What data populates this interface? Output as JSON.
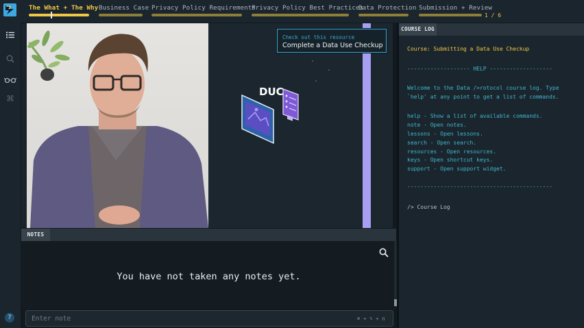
{
  "header": {
    "lessons": [
      {
        "label": "The What + The Why",
        "active": true
      },
      {
        "label": "Business Case",
        "active": false
      },
      {
        "label": "Privacy Policy Requirements",
        "active": false
      },
      {
        "label": "Privacy Policy Best Practices",
        "active": false
      },
      {
        "label": "Data Protection",
        "active": false
      },
      {
        "label": "Submission + Review",
        "active": false
      }
    ],
    "progress_text": "1 / 6",
    "accent_color": "#f2c744"
  },
  "sidebar": {
    "icons": [
      "list-icon",
      "search-icon",
      "glasses-icon",
      "command-icon",
      "help-icon"
    ],
    "help_label": "?"
  },
  "video": {
    "resource": {
      "prompt": "Check out this resource",
      "title": "Complete a Data Use Checkup"
    },
    "slide_title": "DUC"
  },
  "notes": {
    "tab_label": "NOTES",
    "empty_message": "You have not taken any notes yet.",
    "input_placeholder": "Enter note",
    "shortcut_hint": "⌘ + ⌥ + n"
  },
  "course_log": {
    "tab_label": "COURSE LOG",
    "course_line": "Course: Submitting a Data Use Checkup",
    "help_header": "------------------- HELP -------------------",
    "welcome_lines": [
      "Welcome to the Data />rotocol course log. Type",
      "`help' at any point to get a list of commands."
    ],
    "commands": [
      "help - Show a list of available commands.",
      "note - Open notes.",
      "lessons - Open lessons.",
      "search - Open search.",
      "resources - Open resources.",
      "keys - Open shortcut keys.",
      "support - Open support widget."
    ],
    "separator": "--------------------------------------------",
    "prompt_line": "/> Course Log"
  }
}
